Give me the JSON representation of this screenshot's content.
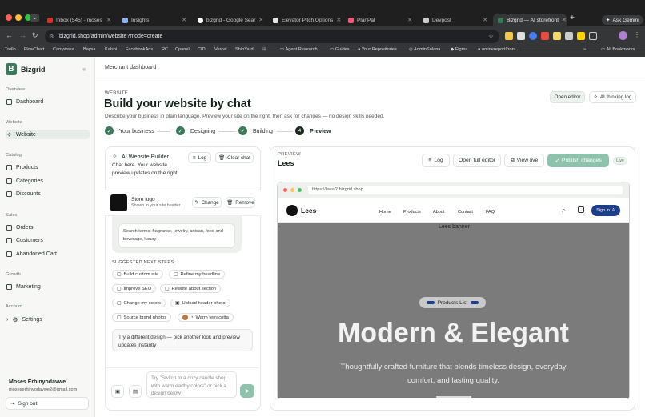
{
  "browser": {
    "tabs": [
      {
        "title": "Inbox (545) - moses",
        "color": "#d93025"
      },
      {
        "title": "Insights",
        "color": "#8ab4f8"
      },
      {
        "title": "bizgrid - Google Sear",
        "color": "#ffffff"
      },
      {
        "title": "Elevator Pitch Options",
        "color": "#e6e6e6"
      },
      {
        "title": "PlanPal",
        "color": "#ff5577"
      },
      {
        "title": "Devpost",
        "color": "#cccccc"
      },
      {
        "title": "Bizgrid — AI storefront",
        "color": "#3d7a5b"
      }
    ],
    "new_tab": "+",
    "ask_gemini": "Ask Gemini",
    "url": "bizgrid.shop/admin/website?mode=create",
    "bookmarks": [
      "Trello",
      "FlowChart",
      "Carrywaka",
      "Baysa",
      "Kalshi",
      "FacebookAds",
      "RC",
      "Cpanel",
      "CID",
      "Vercel",
      "ShipYard",
      "Agent Research",
      "Guides",
      "Your Repositories",
      "AdminSolana",
      "Figma",
      "onlinereport/front...",
      "All Bookmarks"
    ],
    "bookmarks_more": "»"
  },
  "sidebar": {
    "brand": "Bizgrid",
    "collapse": "«",
    "sections": [
      {
        "label": "Overview",
        "items": [
          {
            "label": "Dashboard",
            "icon": "grid-icon"
          }
        ]
      },
      {
        "label": "Website",
        "items": [
          {
            "label": "Website",
            "icon": "sparkle-icon",
            "active": true
          }
        ]
      },
      {
        "label": "Catalog",
        "items": [
          {
            "label": "Products",
            "icon": "package-icon"
          },
          {
            "label": "Categories",
            "icon": "tag-icon"
          },
          {
            "label": "Discounts",
            "icon": "percent-icon"
          }
        ]
      },
      {
        "label": "Sales",
        "items": [
          {
            "label": "Orders",
            "icon": "box-icon"
          },
          {
            "label": "Customers",
            "icon": "users-icon"
          },
          {
            "label": "Abandoned Cart",
            "icon": "cart-icon"
          }
        ]
      },
      {
        "label": "Growth",
        "items": [
          {
            "label": "Marketing",
            "icon": "megaphone-icon"
          }
        ]
      },
      {
        "label": "Account",
        "items": [
          {
            "label": "Settings",
            "icon": "gear-icon"
          }
        ]
      }
    ],
    "user_name": "Moses Erhinyodavwe",
    "user_email": "moseserhinyodavwe2@gmail.com",
    "sign_out": "Sign out"
  },
  "header": {
    "title": "Merchant dashboard"
  },
  "page": {
    "eyebrow": "WEBSITE",
    "title": "Build your website by chat",
    "subtitle": "Describe your business in plain language. Preview your site on the right, then ask for changes — no design skills needed.",
    "open_editor": "Open editor",
    "thinking_log": "AI thinking log",
    "steps": [
      {
        "label": "Your business",
        "done": true
      },
      {
        "label": "Designing",
        "done": true
      },
      {
        "label": "Building",
        "done": true
      },
      {
        "label": "Preview",
        "num": "4",
        "current": true
      }
    ]
  },
  "builder": {
    "title": "AI Website Builder",
    "desc": "Chat here. Your website preview updates on the right.",
    "log": "Log",
    "clear": "Clear chat",
    "store_logo": "Store logo",
    "store_logo_sub": "Shown in your site header",
    "change": "Change",
    "remove": "Remove",
    "search_terms": "Search terms: fragrance, jewelry, artisan, food and beverage, luxury",
    "suggested_title": "SUGGESTED NEXT STEPS",
    "chips": [
      "Build custom site",
      "Refine my headline",
      "Improve SEO",
      "Rewrite about section",
      "Change my colors",
      "Upload header photo",
      "Source brand photos",
      "Warm terracotta"
    ],
    "suggestion_box": "Try a different design — pick another look and preview updates instantly",
    "input_placeholder": "Try \"Switch to a cozy candle shop with warm earthy colors\" or pick a design below"
  },
  "preview": {
    "label": "PREVIEW",
    "site": "Lees",
    "log": "Log",
    "open_full": "Open full editor",
    "view_live": "View live",
    "publish": "Publish changes",
    "status": "Live",
    "mini_url": "https://lees-2.bizgrid.shop",
    "site_brand": "Lees",
    "nav": [
      "Home",
      "Products",
      "About",
      "Contact",
      "FAQ"
    ],
    "sign_in": "Sign in",
    "banner_alt": "Lees banner",
    "pill": "Products List",
    "hero_title": "Modern & Elegant",
    "hero_sub": "Thoughtfully crafted furniture that blends timeless design, everyday comfort, and lasting quality."
  },
  "colors": {
    "accent": "#3d7a5b",
    "publish": "#8fc2ad",
    "signin": "#1d3f8a",
    "banner": "#7b7b7b"
  }
}
